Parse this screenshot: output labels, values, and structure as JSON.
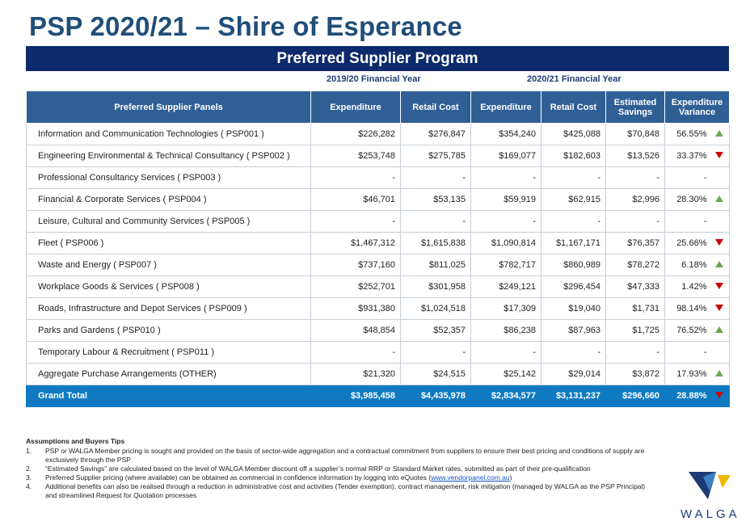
{
  "title": "PSP 2020/21 – Shire of Esperance",
  "banner": "Preferred Supplier Program",
  "fy_labels": {
    "fy1": "2019/20 Financial Year",
    "fy2": "2020/21 Financial Year"
  },
  "table": {
    "headers": {
      "panel": "Preferred Supplier Panels",
      "exp1": "Expenditure",
      "retail1": "Retail Cost",
      "exp2": "Expenditure",
      "retail2": "Retail Cost",
      "savings": "Estimated Savings",
      "variance": "Expenditure Variance"
    },
    "rows": [
      {
        "panel": "Information and Communication Technologies ( PSP001 )",
        "exp1": "$226,282",
        "retail1": "$276,847",
        "exp2": "$354,240",
        "retail2": "$425,088",
        "savings": "$70,848",
        "variance": "56.55%",
        "trend": "up"
      },
      {
        "panel": "Engineering Environmental & Technical Consultancy ( PSP002 )",
        "exp1": "$253,748",
        "retail1": "$275,785",
        "exp2": "$169,077",
        "retail2": "$182,603",
        "savings": "$13,526",
        "variance": "33.37%",
        "trend": "down"
      },
      {
        "panel": "Professional Consultancy Services ( PSP003 )",
        "exp1": "-",
        "retail1": "-",
        "exp2": "-",
        "retail2": "-",
        "savings": "-",
        "variance": "-",
        "trend": "none"
      },
      {
        "panel": "Financial & Corporate Services ( PSP004 )",
        "exp1": "$46,701",
        "retail1": "$53,135",
        "exp2": "$59,919",
        "retail2": "$62,915",
        "savings": "$2,996",
        "variance": "28.30%",
        "trend": "up"
      },
      {
        "panel": "Leisure, Cultural and Community Services ( PSP005 )",
        "exp1": "-",
        "retail1": "-",
        "exp2": "-",
        "retail2": "-",
        "savings": "-",
        "variance": "-",
        "trend": "none"
      },
      {
        "panel": "Fleet ( PSP006 )",
        "exp1": "$1,467,312",
        "retail1": "$1,615,838",
        "exp2": "$1,090,814",
        "retail2": "$1,167,171",
        "savings": "$76,357",
        "variance": "25.66%",
        "trend": "down"
      },
      {
        "panel": "Waste and Energy ( PSP007 )",
        "exp1": "$737,160",
        "retail1": "$811,025",
        "exp2": "$782,717",
        "retail2": "$860,989",
        "savings": "$78,272",
        "variance": "6.18%",
        "trend": "up"
      },
      {
        "panel": "Workplace Goods & Services ( PSP008 )",
        "exp1": "$252,701",
        "retail1": "$301,958",
        "exp2": "$249,121",
        "retail2": "$296,454",
        "savings": "$47,333",
        "variance": "1.42%",
        "trend": "down"
      },
      {
        "panel": "Roads, Infrastructure and Depot Services ( PSP009 )",
        "exp1": "$931,380",
        "retail1": "$1,024,518",
        "exp2": "$17,309",
        "retail2": "$19,040",
        "savings": "$1,731",
        "variance": "98.14%",
        "trend": "down"
      },
      {
        "panel": "Parks and Gardens ( PSP010 )",
        "exp1": "$48,854",
        "retail1": "$52,357",
        "exp2": "$86,238",
        "retail2": "$87,963",
        "savings": "$1,725",
        "variance": "76.52%",
        "trend": "up"
      },
      {
        "panel": "Temporary Labour & Recruitment ( PSP011 )",
        "exp1": "-",
        "retail1": "-",
        "exp2": "-",
        "retail2": "-",
        "savings": "-",
        "variance": "-",
        "trend": "none"
      },
      {
        "panel": "Aggregate Purchase Arrangements (OTHER)",
        "exp1": "$21,320",
        "retail1": "$24,515",
        "exp2": "$25,142",
        "retail2": "$29,014",
        "savings": "$3,872",
        "variance": "17.93%",
        "trend": "up"
      }
    ],
    "total": {
      "panel": "Grand Total",
      "exp1": "$3,985,458",
      "retail1": "$4,435,978",
      "exp2": "$2,834,577",
      "retail2": "$3,131,237",
      "savings": "$296,660",
      "variance": "28.88%",
      "trend": "down"
    }
  },
  "notes": {
    "heading": "Assumptions and Buyers Tips",
    "items": [
      {
        "num": "1.",
        "text": "PSP or WALGA Member pricing is sought and provided on the basis of sector-wide aggregation and a contractual commitment from suppliers to ensure their best pricing and conditions of supply are exclusively through the PSP"
      },
      {
        "num": "2.",
        "text": "“Estimated Savings” are calculated based on the level of WALGA Member discount off a supplier’s normal RRP or Standard Market rates, submitted as part of their pre-qualification"
      },
      {
        "num": "3.",
        "text_before": "Preferred Supplier pricing (where available) can be obtained as commercial in confidence information by logging into eQuotes (",
        "link": "www.vendorpanel.com.au",
        "text_after": ")"
      },
      {
        "num": "4.",
        "text": "Additional benefits can also be realised through a reduction in administrative cost and activities (Tender exemption), contract management, risk mitigation (managed by WALGA as the PSP Principal) and streamlined Request for Quotation processes"
      }
    ]
  },
  "logo": {
    "text": "WALGA",
    "colors": {
      "blue": "#1f3b75",
      "gold": "#f2b800",
      "light": "#3b7fc4"
    }
  },
  "colors": {
    "title": "#1f4e79",
    "banner": "#0d2a6b",
    "header": "#2f5f95",
    "total": "#0f7ac2",
    "up": "#6aa84f",
    "down": "#cc0000"
  }
}
